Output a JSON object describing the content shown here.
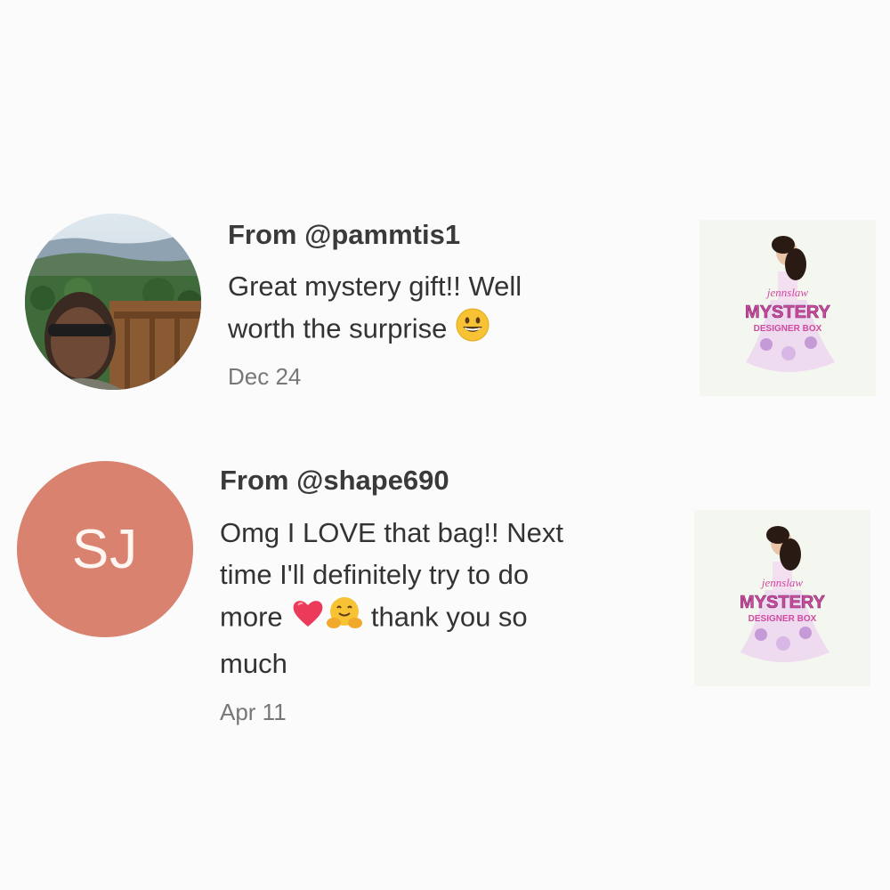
{
  "reviews": [
    {
      "from": "From @pammtis1",
      "message_text": "Great mystery gift!! Well worth the surprise",
      "message_line1": "Great mystery gift!! Well",
      "message_line2": "worth the surprise",
      "emojis": [
        "grinning-face-emoji"
      ],
      "date": "Dec 24",
      "avatar_type": "photo"
    },
    {
      "from": "From @shape690",
      "initials": "SJ",
      "avatar_color": "#d9826f",
      "message_text": "Omg I LOVE that bag!! Next time I'll definitely try to do more thank you so much",
      "message_line1": "Omg I LOVE that bag!! Next",
      "message_line2": "time I'll definitely try to do",
      "message_line3a": "more",
      "message_line3b": "thank you so",
      "message_line4": "much",
      "emojis": [
        "red-heart-emoji",
        "hugging-face-emoji"
      ],
      "date": "Apr 11",
      "avatar_type": "initials"
    }
  ],
  "product_thumbnail": {
    "brand": "jennslaw",
    "title": "MYSTERY",
    "subtitle": "DESIGNER BOX"
  }
}
